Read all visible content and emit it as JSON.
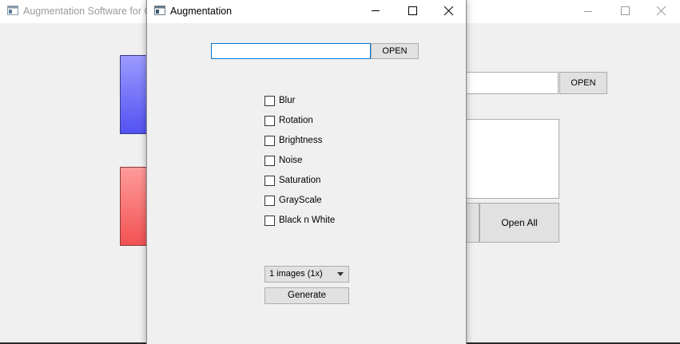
{
  "main_window": {
    "title": "Augmentation Software for C",
    "open_label": "OPEN",
    "open_all_label": "Open All"
  },
  "dialog": {
    "title": "Augmentation",
    "path_value": "",
    "open_label": "OPEN",
    "options": [
      {
        "label": "Blur",
        "checked": false
      },
      {
        "label": "Rotation",
        "checked": false
      },
      {
        "label": "Brightness",
        "checked": false
      },
      {
        "label": "Noise",
        "checked": false
      },
      {
        "label": "Saturation",
        "checked": false
      },
      {
        "label": "GrayScale",
        "checked": false
      },
      {
        "label": "Black n White",
        "checked": false
      }
    ],
    "count_select_value": "1 images (1x)",
    "generate_label": "Generate"
  },
  "colors": {
    "blue_panel": "#5252f2",
    "red_panel": "#f25252",
    "focus_border": "#0078d7"
  }
}
